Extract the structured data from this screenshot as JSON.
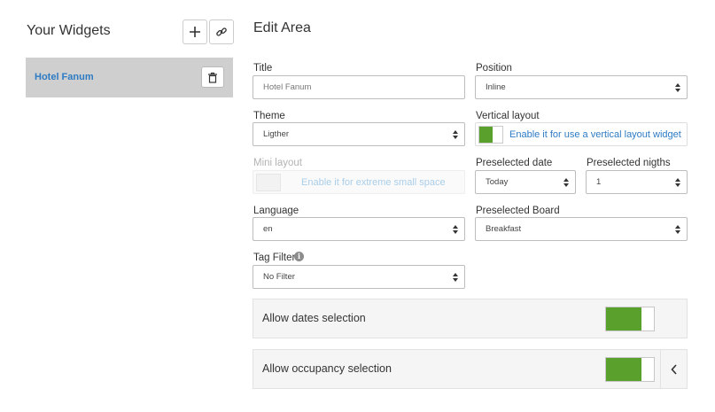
{
  "sidebar": {
    "title": "Your Widgets",
    "add_icon": "plus-icon",
    "link_icon": "link-icon",
    "items": [
      {
        "label": "Hotel Fanum",
        "delete_icon": "trash-icon"
      }
    ]
  },
  "edit": {
    "title": "Edit Area",
    "title_field": {
      "label": "Title",
      "value": "Hotel Fanum"
    },
    "position": {
      "label": "Position",
      "value": "Inline"
    },
    "theme": {
      "label": "Theme",
      "value": "Ligther"
    },
    "vertical_layout": {
      "label": "Vertical layout",
      "text": "Enable it for use a vertical layout widget",
      "enabled": true
    },
    "mini_layout": {
      "label": "Mini layout",
      "text": "Enable it for extreme small space",
      "enabled": false,
      "disabled": true
    },
    "preselected_date": {
      "label": "Preselected date",
      "value": "Today"
    },
    "preselected_nights": {
      "label": "Preselected nigths",
      "value": "1"
    },
    "language": {
      "label": "Language",
      "value": "en"
    },
    "preselected_board": {
      "label": "Preselected Board",
      "value": "Breakfast"
    },
    "tag_filter": {
      "label": "Tag Filter",
      "value": "No Filter",
      "info_icon": "info-icon"
    },
    "allow_dates": {
      "label": "Allow dates selection",
      "enabled": true
    },
    "allow_occupancy": {
      "label": "Allow occupancy selection",
      "enabled": true,
      "expand_icon": "chevron-left-icon"
    }
  },
  "colors": {
    "accent_green": "#5aa02c",
    "link_blue": "#2d7bc4",
    "selected_item_bg": "#cfcfcf"
  }
}
